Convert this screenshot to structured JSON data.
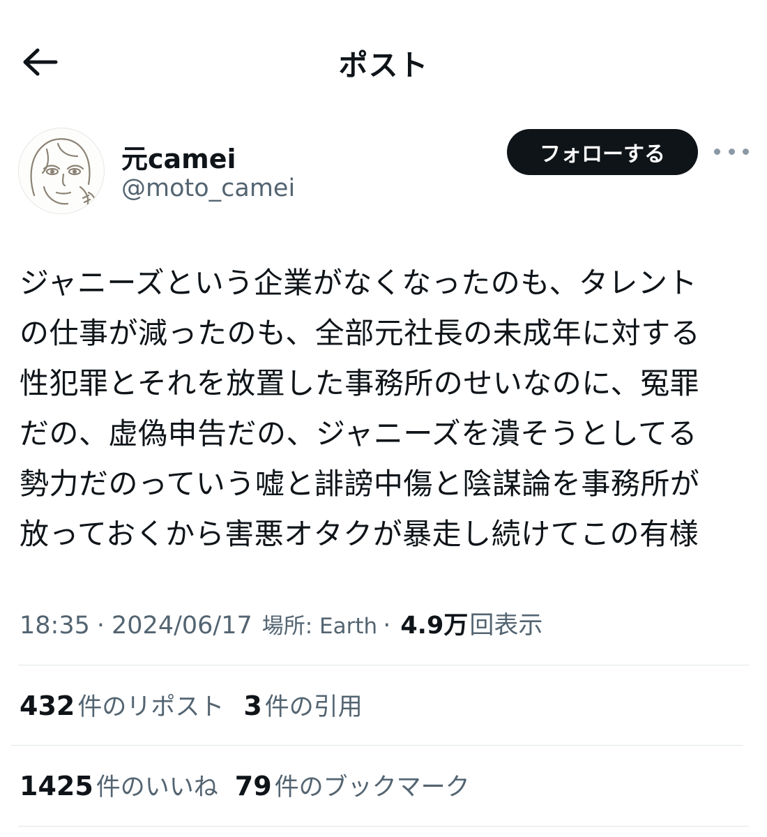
{
  "header": {
    "title": "ポスト",
    "back_icon": "arrow-left-icon"
  },
  "author": {
    "display_name": "元camei",
    "handle": "@moto_camei",
    "follow_label": "フォローする",
    "more_icon": "more-dots-icon"
  },
  "post": {
    "lines": [
      "ジャニーズという企業がなくなったのも、タレント",
      "の仕事が減ったのも、全部元社長の未成年に対する",
      "性犯罪とそれを放置した事務所のせいなのに、冤罪",
      "だの、虚偽申告だの、ジャニーズを潰そうとしてる",
      "勢力だのっていう嘘と誹謗中傷と陰謀論を事務所が",
      "放っておくから害悪オタクが暴走し続けてこの有様"
    ]
  },
  "meta": {
    "time": "18:35",
    "date": "2024/06/17",
    "location": "場所: Earth",
    "views_count": "4.9万",
    "views_label": "回表示"
  },
  "stats": {
    "reposts": {
      "count": "432",
      "label": "件のリポスト"
    },
    "quotes": {
      "count": "3",
      "label": "件の引用"
    },
    "likes": {
      "count": "1425",
      "label": "件のいいね"
    },
    "bookmarks": {
      "count": "79",
      "label": "件のブックマーク"
    }
  },
  "colors": {
    "text_primary": "#0f1419",
    "text_secondary": "#536471",
    "divider": "#e1e6ea",
    "button_bg": "#0f1419"
  }
}
